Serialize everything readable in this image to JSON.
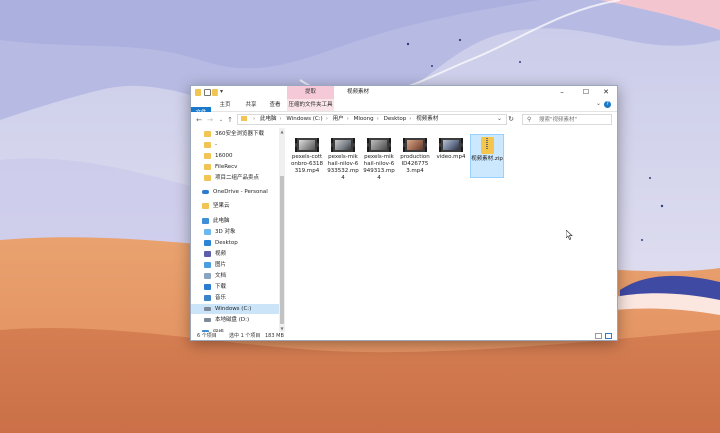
{
  "window": {
    "title": "视频素材",
    "context_tab": "提取",
    "colors": {
      "accent": "#1979ca",
      "context_tab": "#f6c9d8",
      "selection": "#cce8ff",
      "folder": "#f1c453"
    }
  },
  "ribbon": {
    "tabs": [
      "文件",
      "主页",
      "共享",
      "查看",
      "压缩的文件夹工具"
    ],
    "help_icon": "?"
  },
  "address": {
    "crumbs": [
      "此电脑",
      "Windows (C:)",
      "用户",
      "Mloong",
      "Desktop",
      "视频素材"
    ],
    "search_placeholder": "搜索\"视频素材\""
  },
  "nav": {
    "items": [
      {
        "label": "360安全浏览器下载",
        "icon": "folder-icon"
      },
      {
        "label": "-",
        "icon": "folder-icon"
      },
      {
        "label": "16000",
        "icon": "folder-icon"
      },
      {
        "label": "FileRecv",
        "icon": "folder-icon"
      },
      {
        "label": "项目二组产品卖点",
        "icon": "folder-icon"
      },
      {
        "label": "OneDrive - Personal",
        "icon": "cloud-icon"
      },
      {
        "label": "坚果云",
        "icon": "nutstore-icon"
      },
      {
        "label": "此电脑",
        "icon": "computer-icon"
      },
      {
        "label": "3D 对象",
        "icon": "cube-icon"
      },
      {
        "label": "Desktop",
        "icon": "desktop-icon"
      },
      {
        "label": "视频",
        "icon": "video-icon"
      },
      {
        "label": "图片",
        "icon": "pictures-icon"
      },
      {
        "label": "文档",
        "icon": "documents-icon"
      },
      {
        "label": "下载",
        "icon": "download-icon"
      },
      {
        "label": "音乐",
        "icon": "music-icon"
      },
      {
        "label": "Windows (C:)",
        "icon": "drive-icon"
      },
      {
        "label": "本地磁盘 (D:)",
        "icon": "drive-icon"
      },
      {
        "label": "网络",
        "icon": "network-icon"
      }
    ]
  },
  "files": [
    {
      "name": "pexels-cottonbro-6318319.mp4",
      "type": "video"
    },
    {
      "name": "pexels-mikhail-nilov-6933532.mp4",
      "type": "video"
    },
    {
      "name": "pexels-mikhail-nilov-6949313.mp4",
      "type": "video"
    },
    {
      "name": "production ID4267753.mp4",
      "type": "video"
    },
    {
      "name": "video.mp4",
      "type": "video"
    },
    {
      "name": "视频素材.zip",
      "type": "zip",
      "selected": true
    }
  ],
  "status": {
    "count": "6 个项目",
    "selected": "选中 1 个项目",
    "size": "183 MB"
  }
}
